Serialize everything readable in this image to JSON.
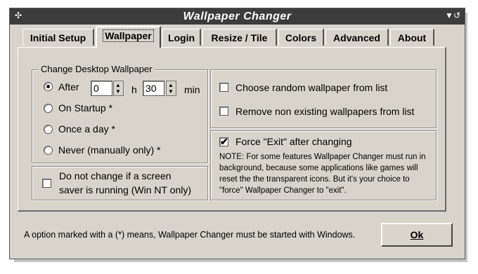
{
  "window": {
    "title": "Wallpaper Changer",
    "system_menu_icon": "diamond-dots-icon",
    "title_buttons": [
      "minimize-triangle-icon",
      "close-arrow-icon"
    ]
  },
  "tabs": [
    {
      "label": "Initial Setup",
      "active": false
    },
    {
      "label": "Wallpaper",
      "active": true
    },
    {
      "label": "Login",
      "active": false
    },
    {
      "label": "Resize / Tile",
      "active": false
    },
    {
      "label": "Colors",
      "active": false
    },
    {
      "label": "Advanced",
      "active": false
    },
    {
      "label": "About",
      "active": false
    }
  ],
  "change_group": {
    "legend": "Change Desktop Wallpaper",
    "after_label": "After",
    "hours_value": "0",
    "hours_unit": "h",
    "minutes_value": "30",
    "minutes_unit": "min",
    "on_startup_label": "On Startup  *",
    "once_a_day_label": "Once a day *",
    "never_label": "Never (manually only) *",
    "selected": "after"
  },
  "screensaver": {
    "label_line1": "Do not change if a screen",
    "label_line2": "saver is running (Win NT only)",
    "checked": false
  },
  "list_options": {
    "random_label": "Choose random wallpaper from list",
    "random_checked": false,
    "remove_label": "Remove non existing wallpapers from list",
    "remove_checked": false
  },
  "force_exit": {
    "label": "Force \"Exit\" after changing",
    "checked": true,
    "note": "NOTE: For some features Wallpaper Changer must run in background, because some applications like games will reset the the transparent icons. But it's your choice to \"force\" Wallpaper Changer to \"exit\"."
  },
  "status": {
    "text": "A option marked with a (*) means, Wallpaper Changer must be started with Windows."
  },
  "ok_button": {
    "label": "Ok"
  },
  "colors": {
    "face": "#d8d4cc",
    "titlebar": "#3c3c3c"
  }
}
